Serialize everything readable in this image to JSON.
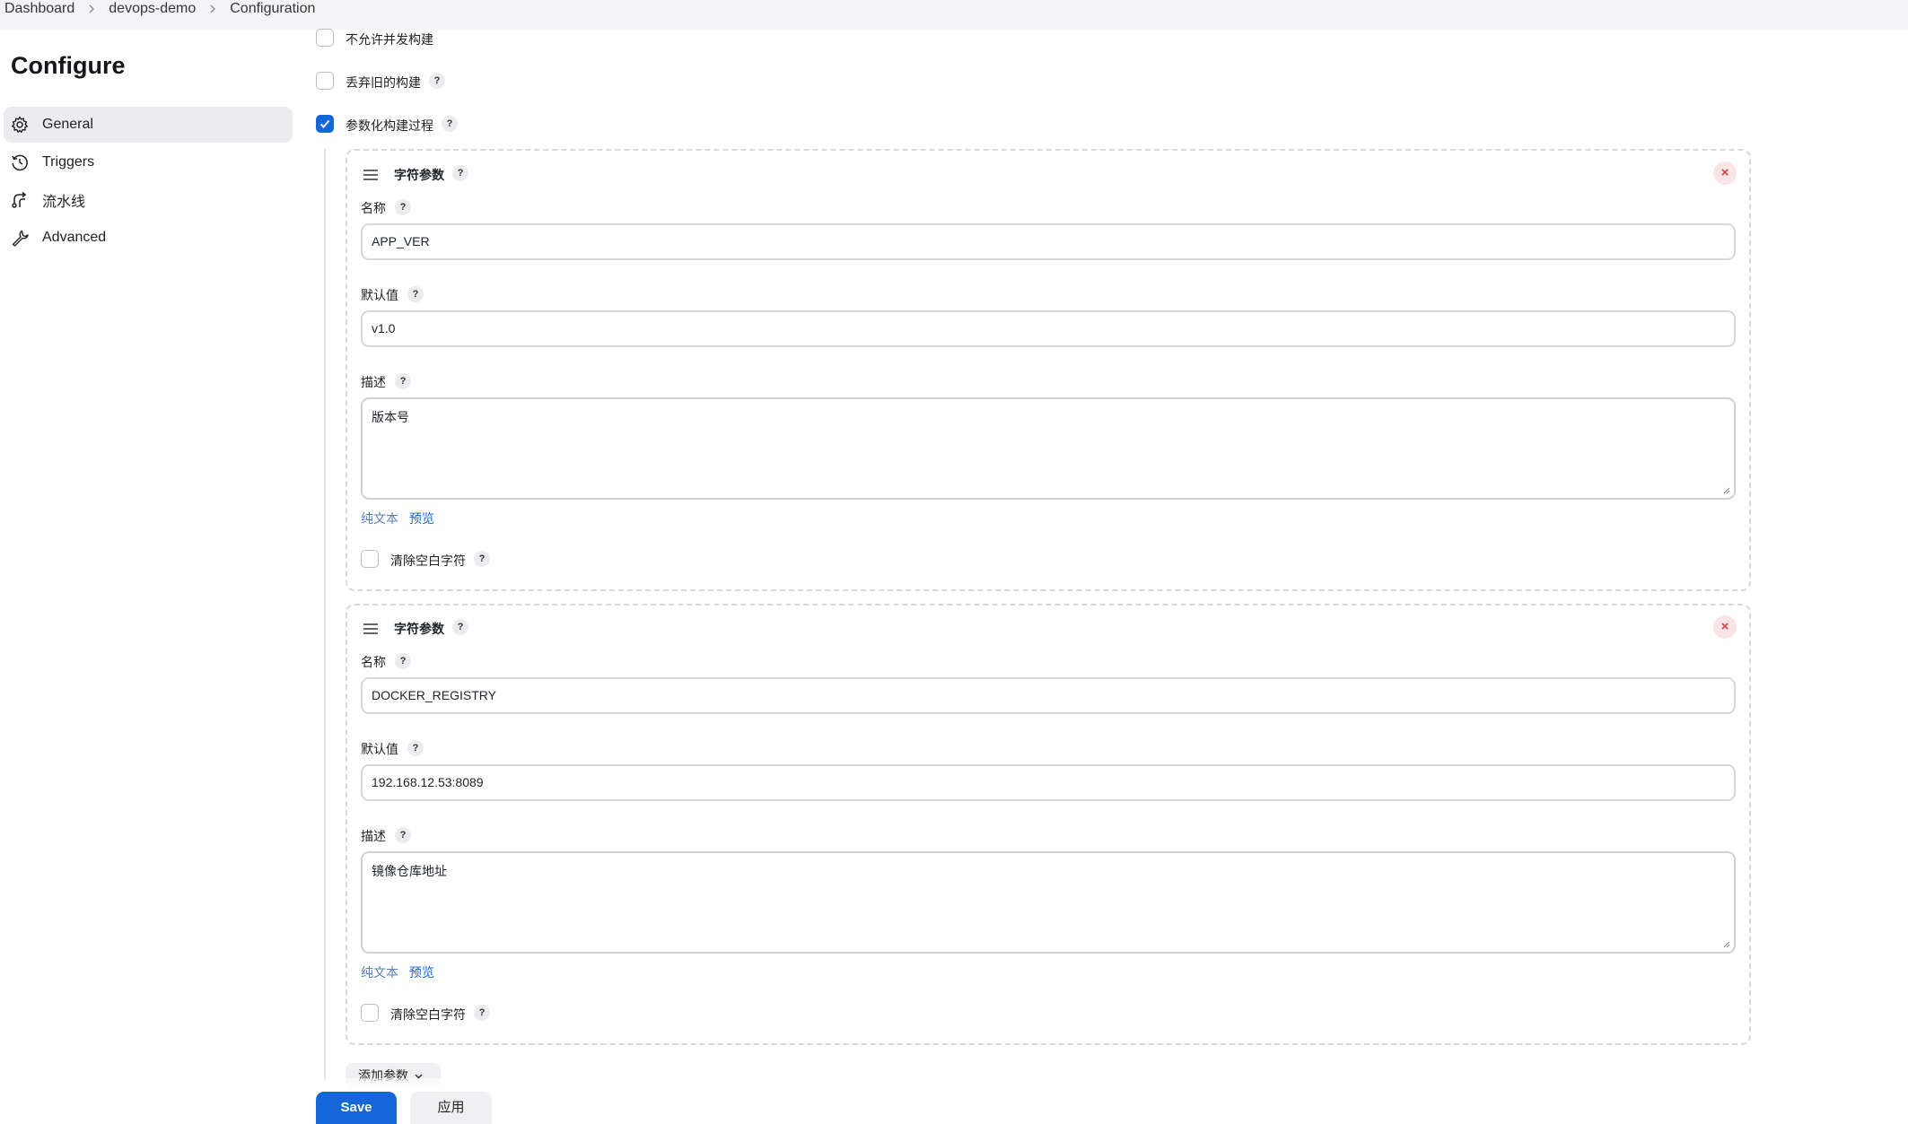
{
  "breadcrumb": {
    "items": [
      "Dashboard",
      "devops-demo",
      "Configuration"
    ]
  },
  "sidebar": {
    "title": "Configure",
    "items": [
      {
        "label": "General",
        "icon": "gear-icon",
        "active": true
      },
      {
        "label": "Triggers",
        "icon": "clock-icon",
        "active": false
      },
      {
        "label": "流水线",
        "icon": "pipeline-icon",
        "active": false
      },
      {
        "label": "Advanced",
        "icon": "wrench-icon",
        "active": false
      }
    ]
  },
  "options": {
    "no_concurrent": {
      "label": "不允许并发构建",
      "checked": false
    },
    "discard_old": {
      "label": "丢弃旧的构建",
      "checked": false
    },
    "parameterized": {
      "label": "参数化构建过程",
      "checked": true
    }
  },
  "help_glyph": "?",
  "close_glyph": "×",
  "params": [
    {
      "type_label": "字符参数",
      "name_label": "名称",
      "name_value": "APP_VER",
      "default_label": "默认值",
      "default_value": "v1.0",
      "desc_label": "描述",
      "desc_value": "版本号",
      "format_plain": "纯文本",
      "format_preview": "预览",
      "trim_label": "清除空白字符",
      "trim_checked": false
    },
    {
      "type_label": "字符参数",
      "name_label": "名称",
      "name_value": "DOCKER_REGISTRY",
      "default_label": "默认值",
      "default_value": "192.168.12.53:8089",
      "desc_label": "描述",
      "desc_value": "镜像仓库地址",
      "format_plain": "纯文本",
      "format_preview": "预览",
      "trim_label": "清除空白字符",
      "trim_checked": false
    }
  ],
  "add_param_label": "添加参数",
  "buttons": {
    "save": "Save",
    "apply": "应用"
  },
  "colors": {
    "accent": "#1467d8",
    "danger": "#d93d45",
    "active_nav_bg": "#ececf0"
  }
}
